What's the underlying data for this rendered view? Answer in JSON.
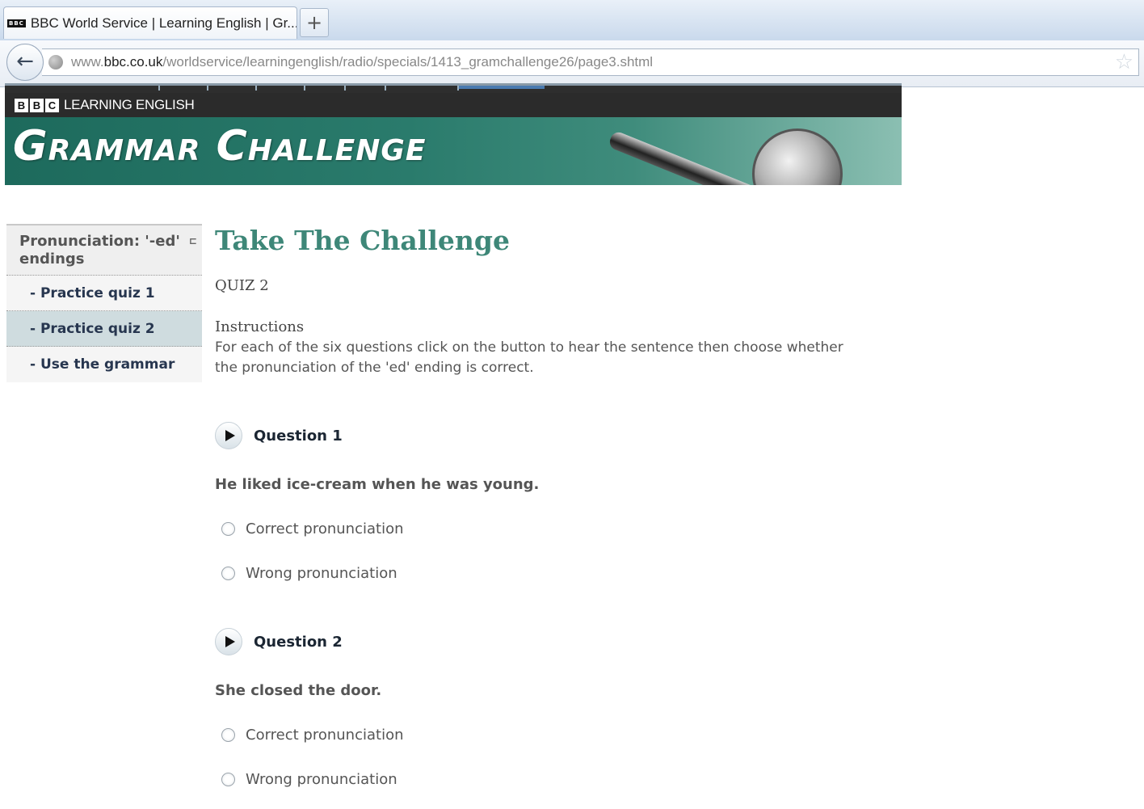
{
  "browser": {
    "tab_title": "BBC World Service | Learning English | Gr...",
    "tab_favicon": "BBC",
    "new_tab_symbol": "+",
    "url_prefix": "www.",
    "url_domain": "bbc.co.uk",
    "url_path": "/worldservice/learningenglish/radio/specials/1413_gramchallenge26/page3.shtml"
  },
  "site": {
    "bbc_letters": [
      "B",
      "B",
      "C"
    ],
    "name": "LEARNING ENGLISH",
    "banner_title": "Grammar Challenge"
  },
  "sidebar": {
    "section_title": "Pronunciation: '-ed' endings",
    "toggle_icon": "collapse-icon",
    "items": [
      {
        "label": "- Practice quiz 1",
        "active": false
      },
      {
        "label": "- Practice quiz 2",
        "active": true
      },
      {
        "label": "- Use the grammar",
        "active": false
      }
    ]
  },
  "main": {
    "title": "Take The Challenge",
    "quiz_label": "QUIZ 2",
    "instructions_heading": "Instructions",
    "instructions_text": "For each of the six questions click on the button to hear the sentence then choose whether the pronunciation of the 'ed' ending is correct.",
    "questions": [
      {
        "label": "Question 1",
        "sentence": "He liked ice-cream when he was young.",
        "options": [
          "Correct pronunciation",
          "Wrong pronunciation"
        ]
      },
      {
        "label": "Question 2",
        "sentence": "She closed the door.",
        "options": [
          "Correct pronunciation",
          "Wrong pronunciation"
        ]
      }
    ]
  },
  "colors": {
    "title_green": "#3e8778",
    "banner_green": "#1d6a5c",
    "active_sidebar": "#cfdcdf"
  }
}
